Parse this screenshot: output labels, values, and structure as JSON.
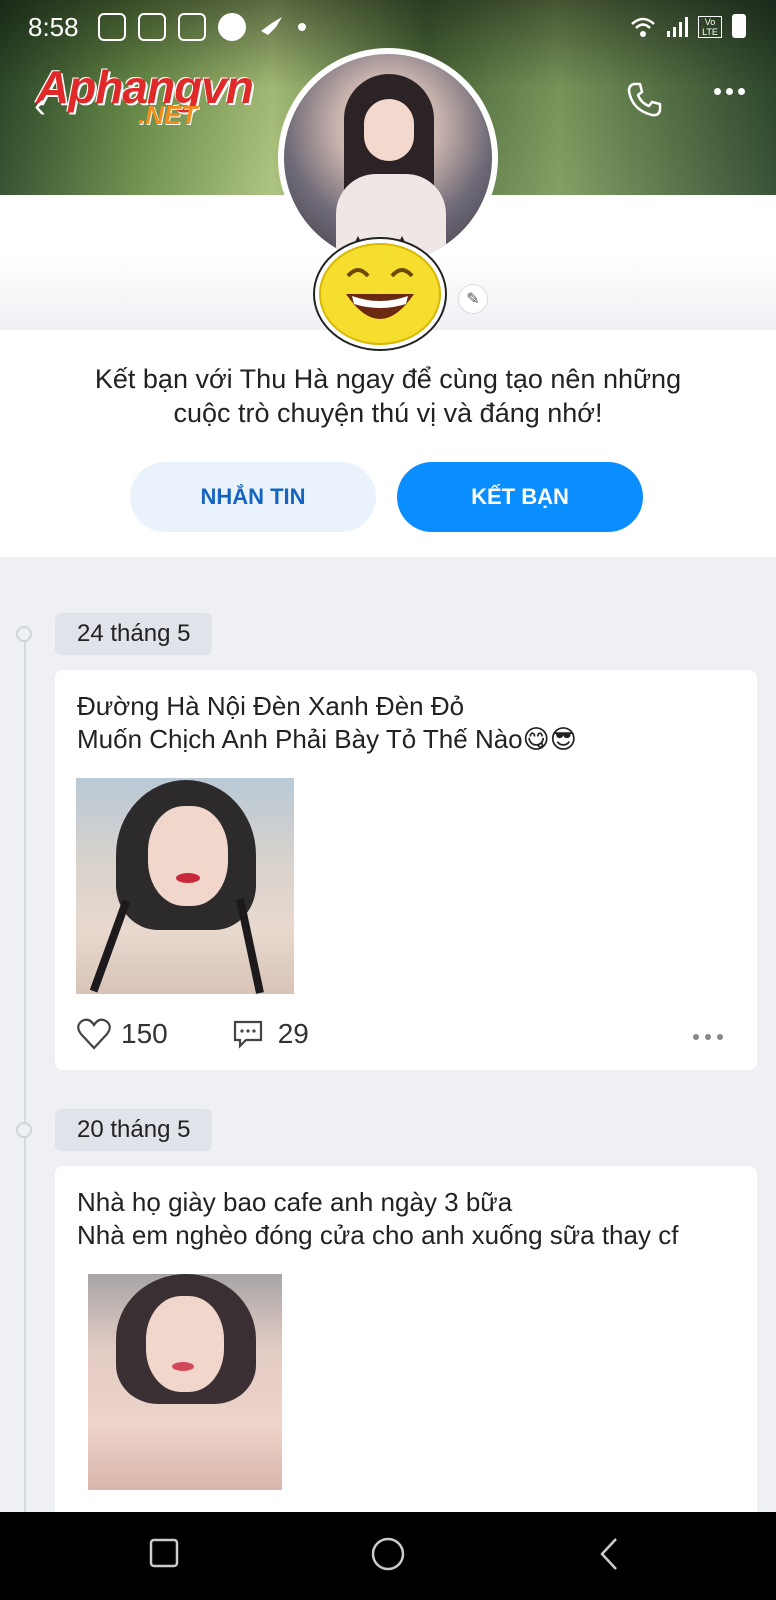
{
  "status_bar": {
    "time": "8:58",
    "carrier_badge": "Vo LTE"
  },
  "watermark": {
    "main": "Aphangvn",
    "sub": ".NET"
  },
  "profile": {
    "intro_text_line1": "Kết bạn với Thu Hà ngay để cùng tạo nên những",
    "intro_text_line2": "cuộc trò chuyện thú vị và đáng nhớ!",
    "message_button": "NHẮN TIN",
    "add_friend_button": "KẾT BẠN"
  },
  "posts": [
    {
      "date": "24 tháng 5",
      "text_line1": "Đường Hà Nội Đèn Xanh Đèn Đỏ",
      "text_line2": "Muốn Chịch Anh Phải Bày Tỏ Thế Nào😋😎",
      "likes": "150",
      "comments": "29"
    },
    {
      "date": "20 tháng 5",
      "text_line1": "Nhà họ giày bao cafe anh ngày 3 bữa",
      "text_line2": "Nhà em nghèo đóng cửa cho anh xuống sữa thay cf"
    }
  ],
  "colors": {
    "accent": "#0a8dff",
    "secondary_button_bg": "#eaf3fc",
    "page_bg": "#eef0f4"
  }
}
